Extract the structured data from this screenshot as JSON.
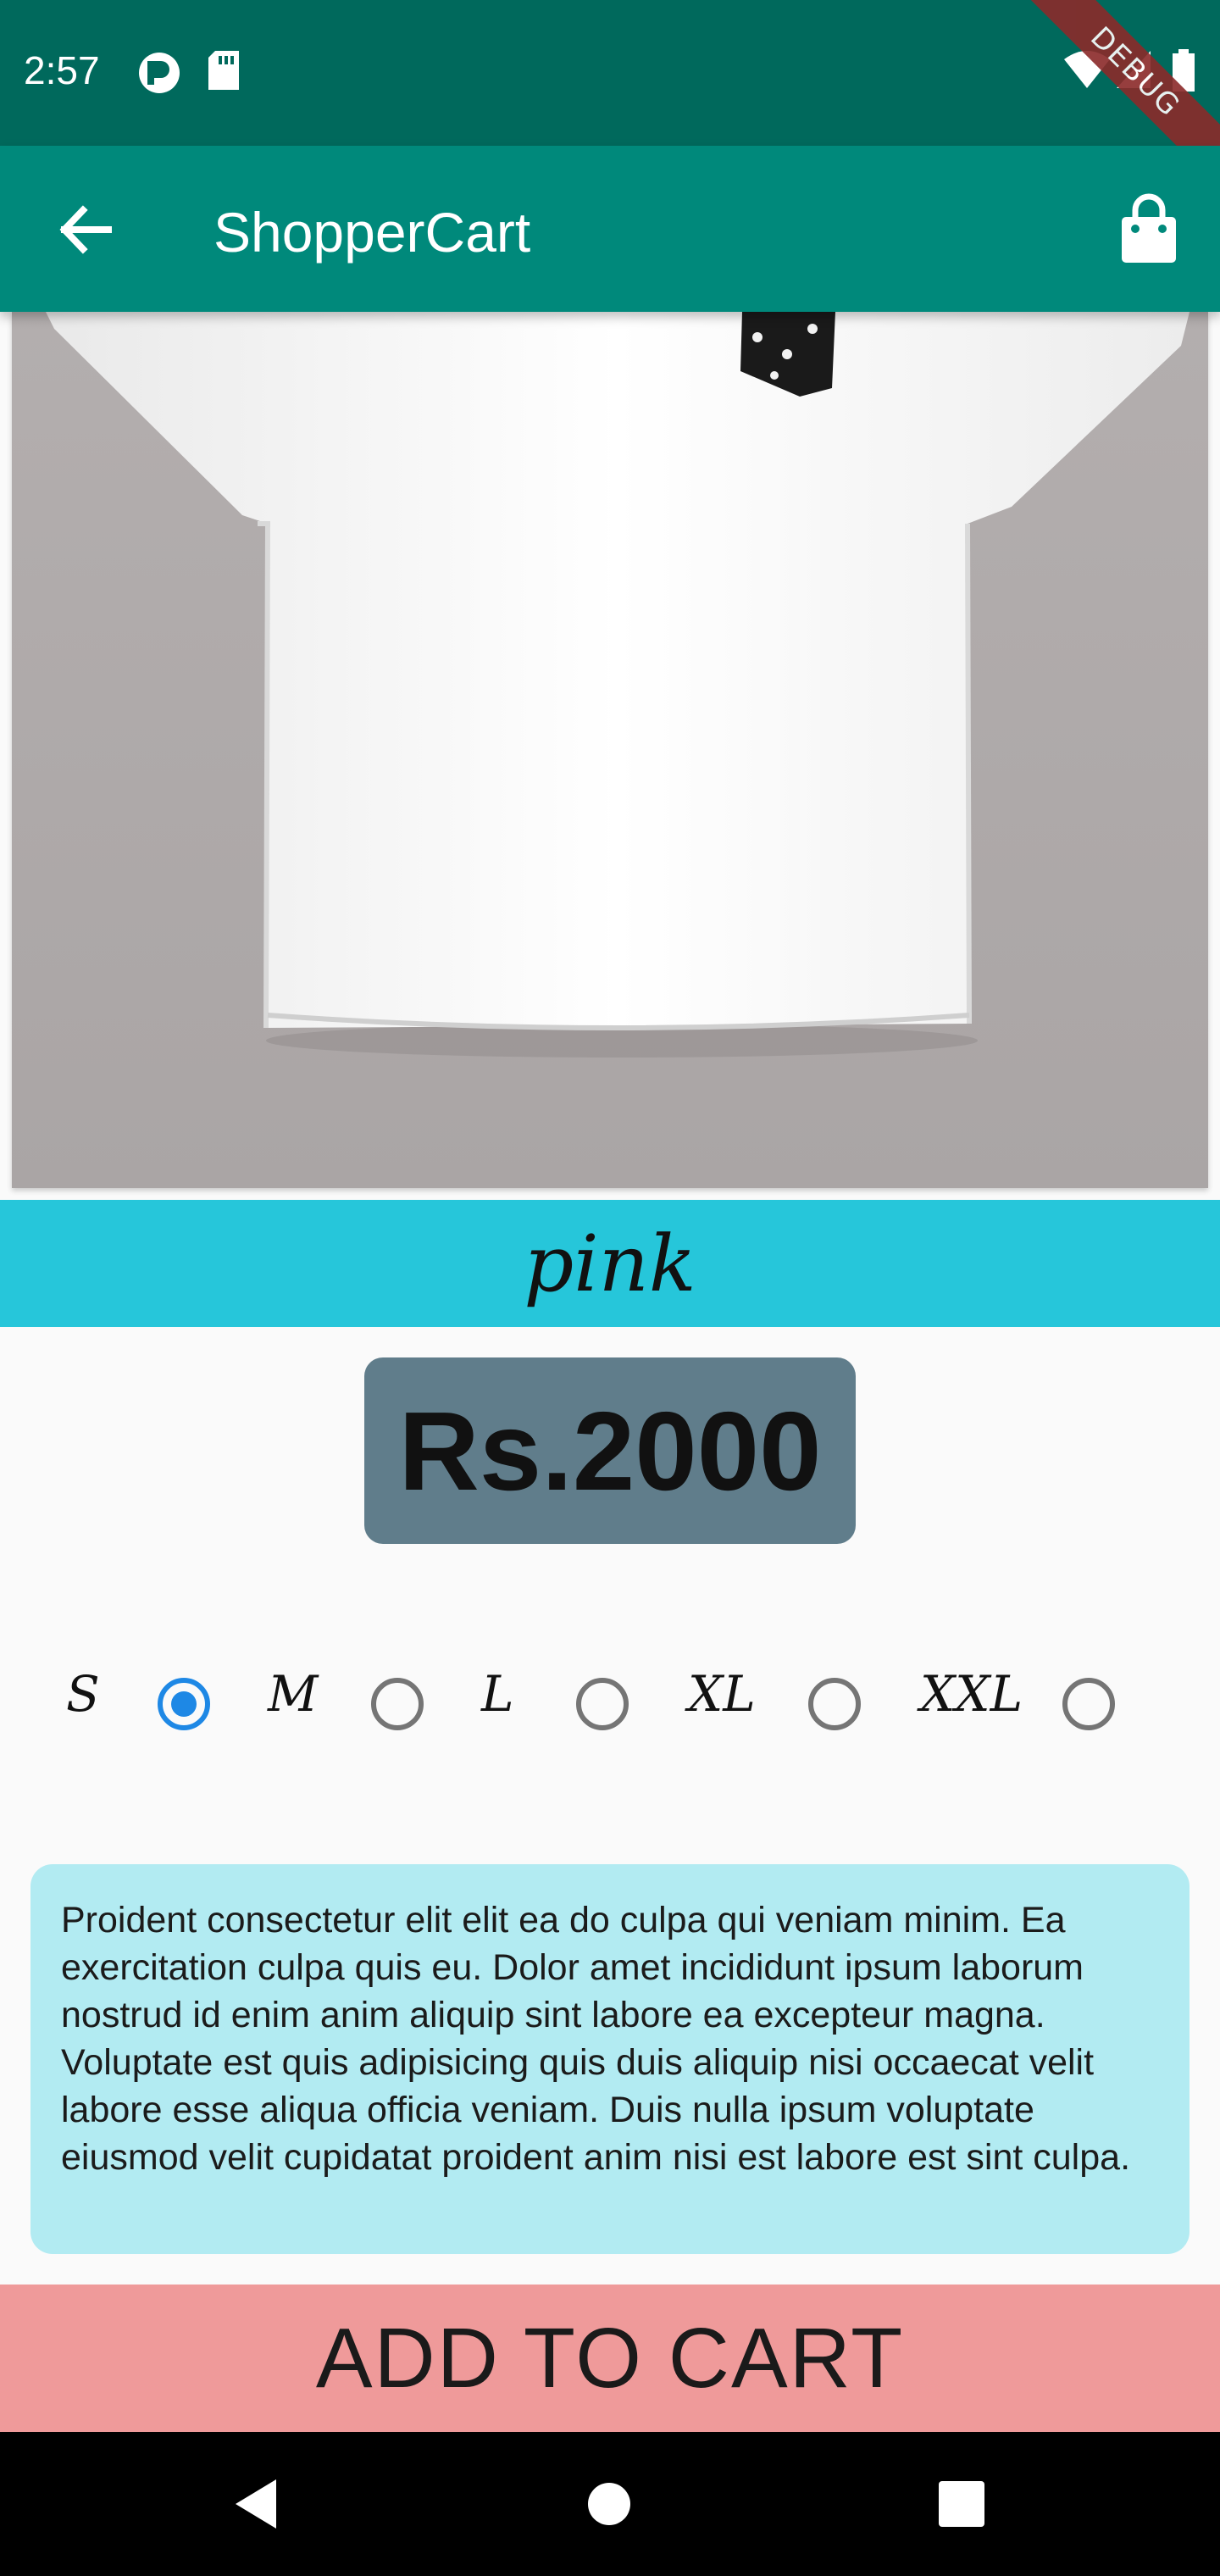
{
  "status_bar": {
    "time": "2:57",
    "debug_label": "DEBUG"
  },
  "app_bar": {
    "title": "ShopperCart"
  },
  "product": {
    "color": "pink",
    "price": "Rs.2000",
    "sizes": [
      {
        "label": "S",
        "selected": true
      },
      {
        "label": "M",
        "selected": false
      },
      {
        "label": "L",
        "selected": false
      },
      {
        "label": "XL",
        "selected": false
      },
      {
        "label": "XXL",
        "selected": false
      }
    ],
    "description": "Proident consectetur elit elit ea do culpa qui veniam minim. Ea exercitation culpa quis eu. Dolor amet incididunt ipsum laborum nostrud id enim anim aliquip sint labore ea excepteur magna. Voluptate est quis adipisicing quis duis aliquip nisi occaecat velit labore esse aliqua officia veniam. Duis nulla ipsum voluptate eiusmod velit cupidatat proident anim nisi est labore est sint culpa."
  },
  "actions": {
    "add_to_cart": "ADD TO CART"
  },
  "colors": {
    "status_bar": "#00695c",
    "app_bar": "#00897b",
    "color_bar": "#26c6da",
    "price_box": "#607d8b",
    "description_card": "#b2ebf2",
    "add_to_cart": "#ef9a9a",
    "radio_selected": "#1e88e5"
  },
  "icons": {
    "back": "arrow-left-icon",
    "cart": "shopping-bag-icon",
    "nav_back": "triangle-back-icon",
    "nav_home": "circle-home-icon",
    "nav_recents": "square-recents-icon"
  }
}
